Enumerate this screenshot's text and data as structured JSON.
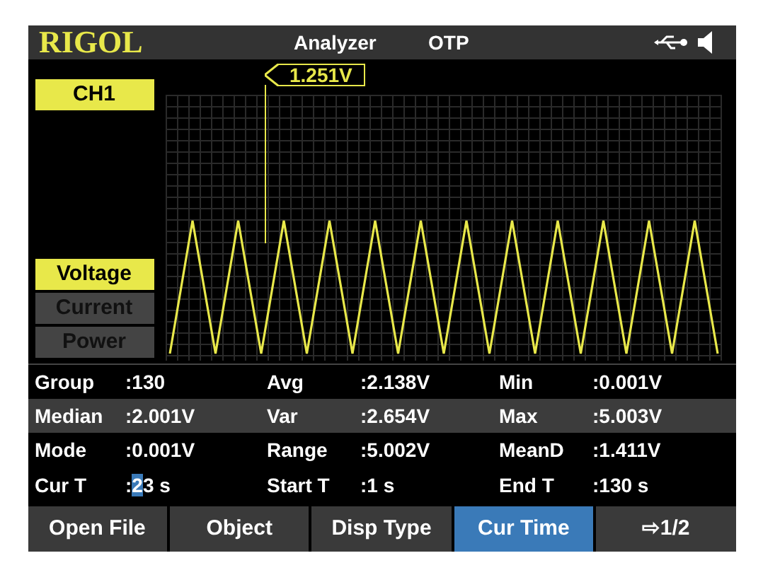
{
  "header": {
    "logo": "RIGOL",
    "mode": "Analyzer",
    "protection": "OTP"
  },
  "channel": "CH1",
  "cursor": {
    "reading": "1.251V"
  },
  "display_types": [
    {
      "label": "Voltage",
      "selected": true
    },
    {
      "label": "Current",
      "selected": false
    },
    {
      "label": "Power",
      "selected": false
    }
  ],
  "stats": [
    [
      {
        "label": "Group",
        "value": ":130"
      },
      {
        "label": "Avg",
        "value": ":2.138V"
      },
      {
        "label": "Min",
        "value": ":0.001V"
      }
    ],
    [
      {
        "label": "Median",
        "value": ":2.001V"
      },
      {
        "label": "Var",
        "value": ":2.654V"
      },
      {
        "label": "Max",
        "value": ":5.003V"
      }
    ],
    [
      {
        "label": "Mode",
        "value": ":0.001V"
      },
      {
        "label": "Range",
        "value": ":5.002V"
      },
      {
        "label": "MeanD",
        "value": ":1.411V"
      }
    ]
  ],
  "times": {
    "cur": {
      "label": "Cur T",
      "value_before": ":",
      "value_cursor": "2",
      "value_after": "3 s"
    },
    "start": {
      "label": "Start T",
      "value": ":1 s"
    },
    "end": {
      "label": "End T",
      "value": ":130 s"
    }
  },
  "softkeys": [
    {
      "label": "Open File",
      "selected": false
    },
    {
      "label": "Object",
      "selected": false
    },
    {
      "label": "Disp Type",
      "selected": false
    },
    {
      "label": "Cur Time",
      "selected": true
    },
    {
      "label": "⇨1/2",
      "selected": false
    }
  ]
}
